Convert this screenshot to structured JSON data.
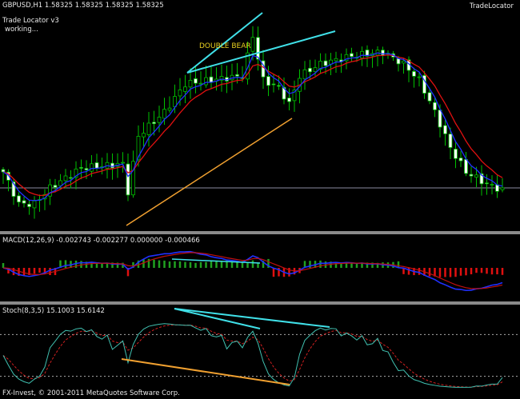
{
  "header": {
    "symbol_line": "GBPUSD,H1  1.58325 1.58325 1.58325 1.58325",
    "indicator_name": "Trade Locator v3",
    "indicator_status": "working...",
    "top_right_label": "TradeLocator"
  },
  "annotations": {
    "pattern_label": "DOUBLE  BEAR"
  },
  "macd": {
    "label": "MACD(12,26,9) -0.002743 -0.002277 0.000000 -0.000466"
  },
  "stoch": {
    "label": "Stoch(8,3,5) 15.1003 15.6142"
  },
  "footer": {
    "copyright": "FX-Invest, © 2001-2011 MetaQuotes Software Corp."
  },
  "colors": {
    "bull": "#00c000",
    "bear_body": "#ffffff",
    "ma_fast": "#2030ff",
    "ma_slow": "#e01010",
    "trendline_cyan": "#40e0e8",
    "trendline_orange": "#f0a030",
    "label_yellow": "#e8d020"
  },
  "chart_data": {
    "type": "candlestick",
    "reference_price": 1.58325,
    "price_keypoints": [
      [
        0,
        1.58525
      ],
      [
        3,
        1.58125
      ],
      [
        6,
        1.58125
      ],
      [
        9,
        1.58325
      ],
      [
        15,
        1.58575
      ],
      [
        23,
        1.58625
      ],
      [
        24,
        1.58275
      ],
      [
        26,
        1.58975
      ],
      [
        31,
        1.59275
      ],
      [
        35,
        1.59625
      ],
      [
        40,
        1.59675
      ],
      [
        46,
        1.59725
      ],
      [
        48,
        1.60225
      ],
      [
        50,
        1.59675
      ],
      [
        53,
        1.59575
      ],
      [
        55,
        1.59375
      ],
      [
        57,
        1.59725
      ],
      [
        61,
        1.59875
      ],
      [
        67,
        1.59975
      ],
      [
        73,
        1.60025
      ],
      [
        77,
        1.59875
      ],
      [
        80,
        1.59675
      ],
      [
        83,
        1.59275
      ],
      [
        86,
        1.58825
      ],
      [
        89,
        1.58525
      ],
      [
        93,
        1.58375
      ],
      [
        96,
        1.58295
      ]
    ],
    "stoch_levels": [
      80,
      20
    ]
  }
}
